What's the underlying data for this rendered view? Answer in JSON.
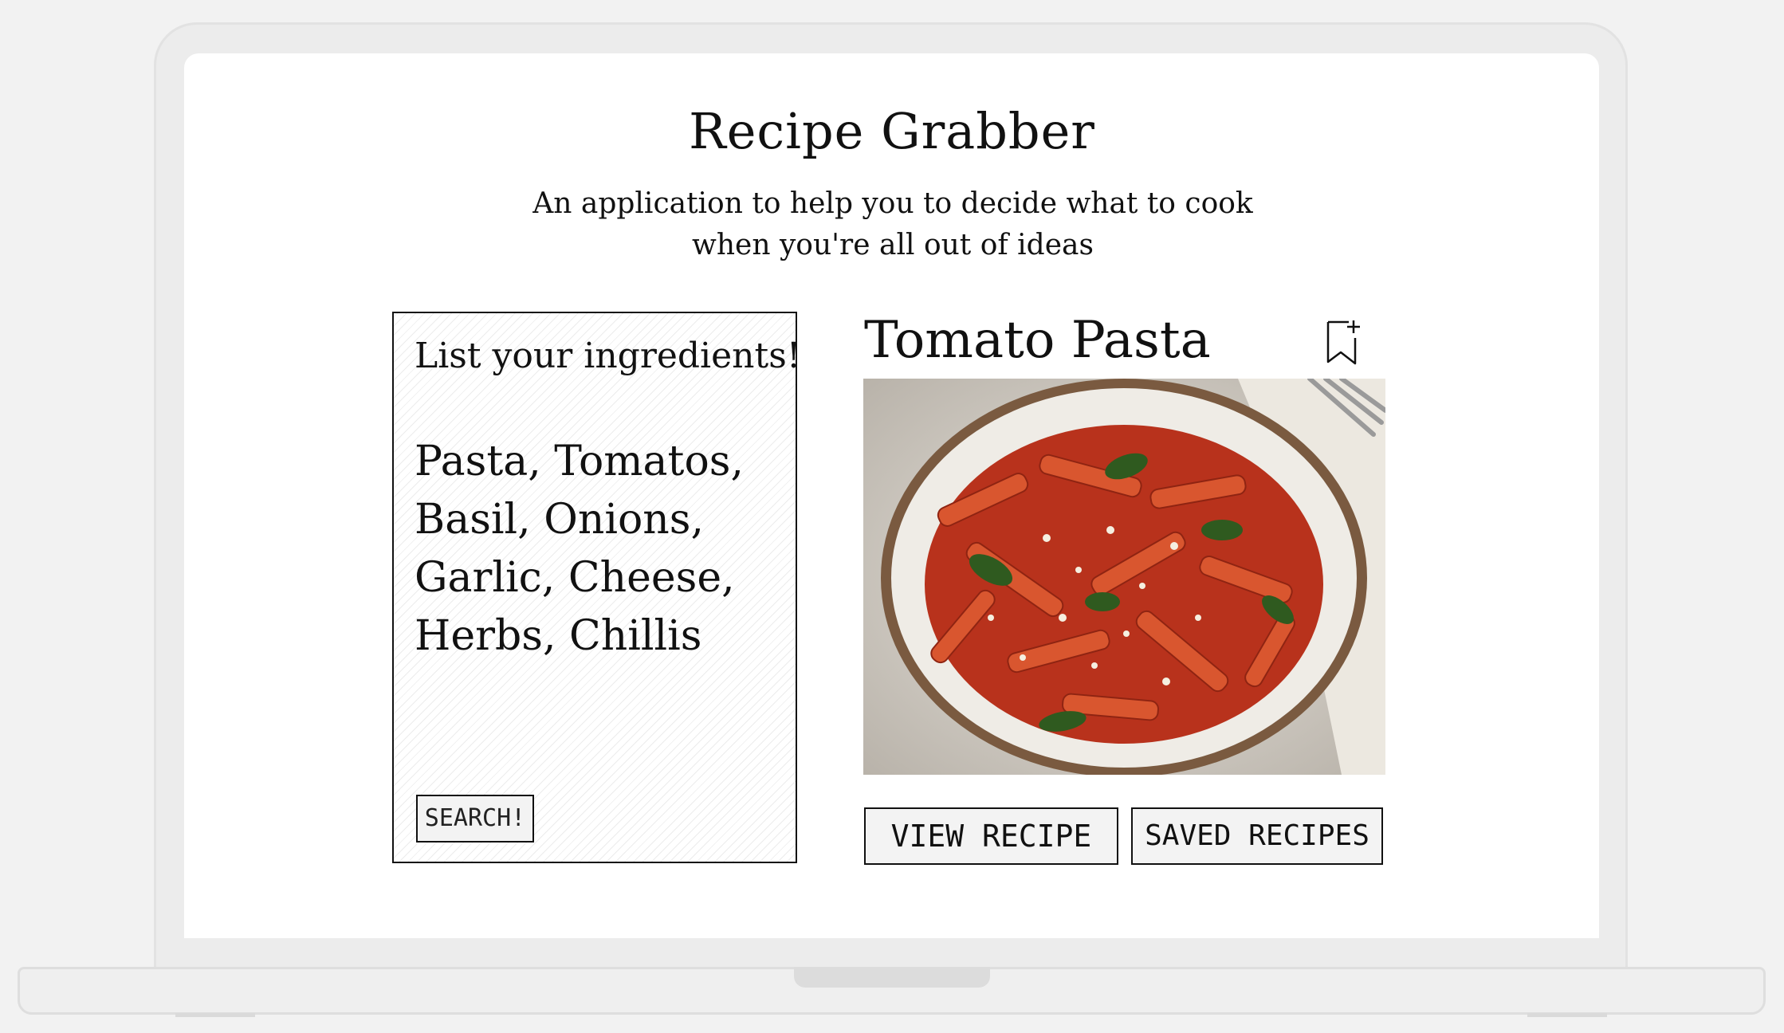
{
  "app": {
    "title": "Recipe Grabber",
    "subtitle": "An application to help you to decide what to cook when you're all out of ideas"
  },
  "ingredients_panel": {
    "heading": "List your ingredients!",
    "value": "Pasta, Tomatos, Basil, Onions, Garlic, Cheese, Herbs, Chillis",
    "search_label": "SEARCH!"
  },
  "recipe": {
    "title": "Tomato Pasta",
    "bookmark_icon": "bookmark-add-icon",
    "image": "penne-pasta-bowl",
    "view_label": "VIEW RECIPE",
    "saved_label": "SAVED RECIPES"
  }
}
